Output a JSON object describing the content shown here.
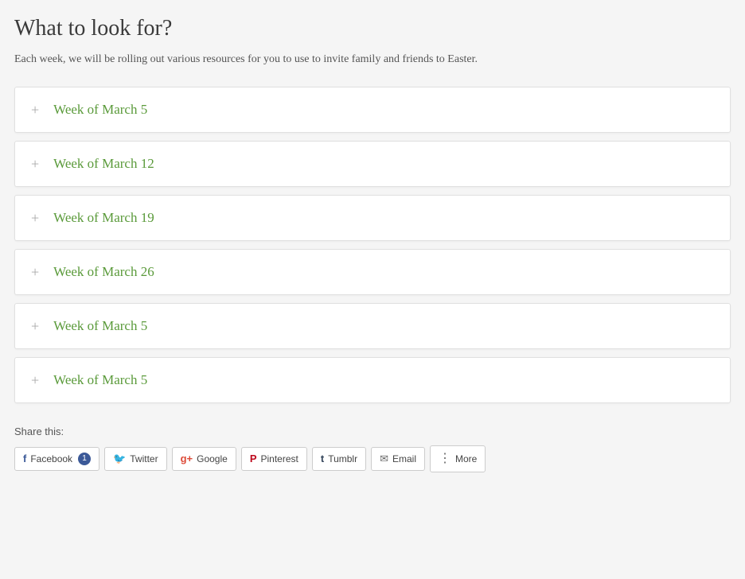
{
  "page": {
    "title": "What to look for?",
    "description": "Each week, we will be rolling out various resources for you to use to invite family and friends to Easter.",
    "accordion_items": [
      {
        "id": 1,
        "label": "Week of March 5"
      },
      {
        "id": 2,
        "label": "Week of March 12"
      },
      {
        "id": 3,
        "label": "Week of March 19"
      },
      {
        "id": 4,
        "label": "Week of March 26"
      },
      {
        "id": 5,
        "label": "Week of March 5"
      },
      {
        "id": 6,
        "label": "Week of March 5"
      }
    ],
    "share": {
      "title": "Share this:",
      "buttons": [
        {
          "id": "facebook",
          "label": "Facebook",
          "icon": "f",
          "class": "facebook",
          "badge": "1"
        },
        {
          "id": "twitter",
          "label": "Twitter",
          "icon": "🐦",
          "class": "twitter",
          "badge": ""
        },
        {
          "id": "google",
          "label": "Google",
          "icon": "G+",
          "class": "google",
          "badge": ""
        },
        {
          "id": "pinterest",
          "label": "Pinterest",
          "icon": "P",
          "class": "pinterest",
          "badge": ""
        },
        {
          "id": "tumblr",
          "label": "Tumblr",
          "icon": "t",
          "class": "tumblr",
          "badge": ""
        },
        {
          "id": "email",
          "label": "Email",
          "icon": "✉",
          "class": "email",
          "badge": ""
        },
        {
          "id": "more",
          "label": "More",
          "icon": "⋮",
          "class": "more",
          "badge": ""
        }
      ]
    }
  }
}
